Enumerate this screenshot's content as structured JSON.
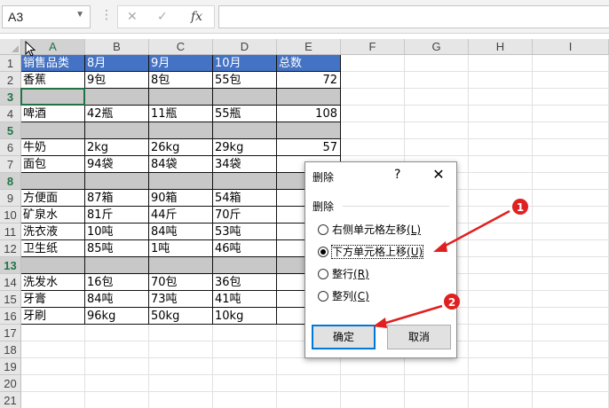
{
  "namebox": {
    "value": "A3"
  },
  "formula_icons": {
    "cancel": "✕",
    "enter": "✓",
    "fx": "fx"
  },
  "colors": {
    "header_blue": "#4472c4",
    "gray_row": "#c8c8c8",
    "accent": "#217346",
    "annotation_red": "#e02020"
  },
  "columns": [
    "A",
    "B",
    "C",
    "D",
    "E",
    "F",
    "G",
    "H",
    "I"
  ],
  "rows": [
    "1",
    "2",
    "3",
    "4",
    "5",
    "6",
    "7",
    "8",
    "9",
    "10",
    "11",
    "12",
    "13",
    "14",
    "15",
    "16",
    "17",
    "18",
    "19",
    "20",
    "21"
  ],
  "table": {
    "headers": [
      "销售品类",
      "8月",
      "9月",
      "10月",
      "总数"
    ],
    "rows": [
      [
        "香蕉",
        "9包",
        "8包",
        "55包",
        "72"
      ],
      [
        "",
        "",
        "",
        "",
        ""
      ],
      [
        "啤酒",
        "42瓶",
        "11瓶",
        "55瓶",
        "108"
      ],
      [
        "",
        "",
        "",
        "",
        ""
      ],
      [
        "牛奶",
        "2kg",
        "26kg",
        "29kg",
        "57"
      ],
      [
        "面包",
        "94袋",
        "84袋",
        "34袋",
        ""
      ],
      [
        "",
        "",
        "",
        "",
        ""
      ],
      [
        "方便面",
        "87箱",
        "90箱",
        "54箱",
        ""
      ],
      [
        "矿泉水",
        "81斤",
        "44斤",
        "70斤",
        ""
      ],
      [
        "洗衣液",
        "10吨",
        "84吨",
        "53吨",
        ""
      ],
      [
        "卫生纸",
        "85吨",
        "1吨",
        "46吨",
        ""
      ],
      [
        "",
        "",
        "",
        "",
        ""
      ],
      [
        "洗发水",
        "16包",
        "70包",
        "36包",
        ""
      ],
      [
        "牙膏",
        "84吨",
        "73吨",
        "41吨",
        ""
      ],
      [
        "牙刷",
        "96kg",
        "50kg",
        "10kg",
        ""
      ]
    ]
  },
  "dialog": {
    "title": "删除",
    "help": "?",
    "close": "✕",
    "group_label": "删除",
    "options": [
      {
        "label": "右侧单元格左移",
        "key": "(L)",
        "selected": false
      },
      {
        "label": "下方单元格上移",
        "key": "(U)",
        "selected": true
      },
      {
        "label": "整行",
        "key": "(R)",
        "selected": false
      },
      {
        "label": "整列",
        "key": "(C)",
        "selected": false
      }
    ],
    "ok_label": "确定",
    "cancel_label": "取消"
  },
  "annotations": {
    "marker1": "1",
    "marker2": "2"
  }
}
